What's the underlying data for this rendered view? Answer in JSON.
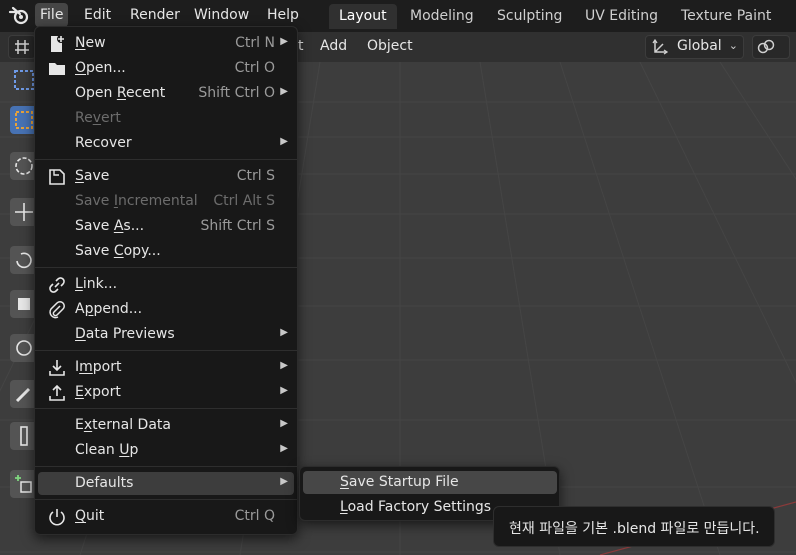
{
  "menubar": {
    "items": [
      "File",
      "Edit",
      "Render",
      "Window",
      "Help"
    ],
    "active": "File"
  },
  "workspaces": {
    "tabs": [
      "Layout",
      "Modeling",
      "Sculpting",
      "UV Editing",
      "Texture Paint"
    ],
    "active": "Layout"
  },
  "header": {
    "partial_label": "t",
    "add_label": "Add",
    "object_label": "Object",
    "orientation_value": "Global"
  },
  "file_menu": {
    "items": [
      {
        "label": "New",
        "shortcut": "Ctrl N",
        "submenu": true,
        "icon": "new-file-icon"
      },
      {
        "label": "Open...",
        "shortcut": "Ctrl O",
        "submenu": false,
        "icon": "folder-icon"
      },
      {
        "label": "Open Recent",
        "shortcut": "Shift Ctrl O",
        "submenu": true
      },
      {
        "label": "Revert",
        "shortcut": "",
        "submenu": false,
        "disabled": true
      },
      {
        "label": "Recover",
        "shortcut": "",
        "submenu": true
      },
      {
        "label": "Save",
        "shortcut": "Ctrl S",
        "submenu": false,
        "icon": "save-icon"
      },
      {
        "label": "Save Incremental",
        "shortcut": "Ctrl Alt S",
        "submenu": false,
        "disabled": true
      },
      {
        "label": "Save As...",
        "shortcut": "Shift Ctrl S",
        "submenu": false
      },
      {
        "label": "Save Copy...",
        "shortcut": "",
        "submenu": false
      },
      {
        "label": "Link...",
        "shortcut": "",
        "submenu": false,
        "icon": "link-icon"
      },
      {
        "label": "Append...",
        "shortcut": "",
        "submenu": false,
        "icon": "paperclip-icon"
      },
      {
        "label": "Data Previews",
        "shortcut": "",
        "submenu": true
      },
      {
        "label": "Import",
        "shortcut": "",
        "submenu": true,
        "icon": "import-icon"
      },
      {
        "label": "Export",
        "shortcut": "",
        "submenu": true,
        "icon": "export-icon"
      },
      {
        "label": "External Data",
        "shortcut": "",
        "submenu": true
      },
      {
        "label": "Clean Up",
        "shortcut": "",
        "submenu": true
      },
      {
        "label": "Defaults",
        "shortcut": "",
        "submenu": true,
        "highlighted": true
      },
      {
        "label": "Quit",
        "shortcut": "Ctrl Q",
        "submenu": false,
        "icon": "power-icon"
      }
    ]
  },
  "defaults_submenu": {
    "items": [
      {
        "label": "Save Startup File",
        "highlighted": true
      },
      {
        "label": "Load Factory Settings",
        "highlighted": false
      }
    ]
  },
  "tooltip": {
    "text": "현재 파일을 기본 .blend 파일로 만듭니다."
  },
  "colors": {
    "menu_bg": "#181818",
    "highlight": "#3d3d3d",
    "accent_tool": "#4772b3",
    "viewport_bg": "#3d3d3d"
  }
}
